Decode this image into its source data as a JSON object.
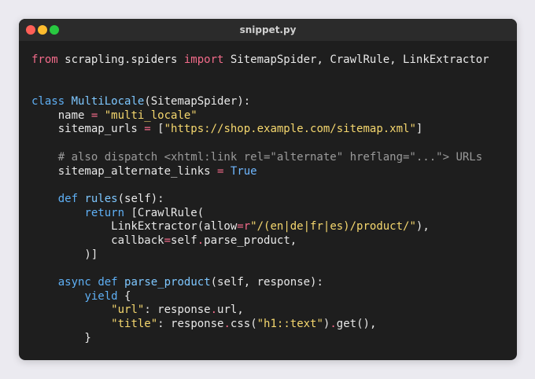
{
  "window": {
    "title": "snippet.py"
  },
  "code": {
    "lines": [
      [
        {
          "t": "from",
          "c": "kw"
        },
        {
          "t": " scrapling.spiders ",
          "c": ""
        },
        {
          "t": "import",
          "c": "kw"
        },
        {
          "t": " SitemapSpider, CrawlRule, LinkExtractor",
          "c": ""
        }
      ],
      [],
      [],
      [
        {
          "t": "class",
          "c": "kw2"
        },
        {
          "t": " ",
          "c": ""
        },
        {
          "t": "MultiLocale",
          "c": "fn"
        },
        {
          "t": "(SitemapSpider):",
          "c": ""
        }
      ],
      [
        {
          "t": "    name ",
          "c": ""
        },
        {
          "t": "=",
          "c": "op"
        },
        {
          "t": " ",
          "c": ""
        },
        {
          "t": "\"multi_locale\"",
          "c": "str"
        }
      ],
      [
        {
          "t": "    sitemap_urls ",
          "c": ""
        },
        {
          "t": "=",
          "c": "op"
        },
        {
          "t": " [",
          "c": ""
        },
        {
          "t": "\"https://shop.example.com/sitemap.xml\"",
          "c": "str"
        },
        {
          "t": "]",
          "c": ""
        }
      ],
      [],
      [
        {
          "t": "    # also dispatch <xhtml:link rel=\"alternate\" hreflang=\"...\"> URLs",
          "c": "cmt"
        }
      ],
      [
        {
          "t": "    sitemap_alternate_links ",
          "c": ""
        },
        {
          "t": "=",
          "c": "op"
        },
        {
          "t": " ",
          "c": ""
        },
        {
          "t": "True",
          "c": "cons"
        }
      ],
      [],
      [
        {
          "t": "    ",
          "c": ""
        },
        {
          "t": "def",
          "c": "kw2"
        },
        {
          "t": " ",
          "c": ""
        },
        {
          "t": "rules",
          "c": "fn"
        },
        {
          "t": "(self):",
          "c": ""
        }
      ],
      [
        {
          "t": "        ",
          "c": ""
        },
        {
          "t": "return",
          "c": "kw2"
        },
        {
          "t": " [CrawlRule(",
          "c": ""
        }
      ],
      [
        {
          "t": "            LinkExtractor(allow",
          "c": ""
        },
        {
          "t": "=",
          "c": "op"
        },
        {
          "t": "r",
          "c": "kw"
        },
        {
          "t": "\"/(en|de|fr|es)/product/\"",
          "c": "str"
        },
        {
          "t": "),",
          "c": ""
        }
      ],
      [
        {
          "t": "            callback",
          "c": ""
        },
        {
          "t": "=",
          "c": "op"
        },
        {
          "t": "self",
          "c": ""
        },
        {
          "t": ".",
          "c": "op"
        },
        {
          "t": "parse_product,",
          "c": ""
        }
      ],
      [
        {
          "t": "        )]",
          "c": ""
        }
      ],
      [],
      [
        {
          "t": "    ",
          "c": ""
        },
        {
          "t": "async",
          "c": "kw2"
        },
        {
          "t": " ",
          "c": ""
        },
        {
          "t": "def",
          "c": "kw2"
        },
        {
          "t": " ",
          "c": ""
        },
        {
          "t": "parse_product",
          "c": "fn"
        },
        {
          "t": "(self, response):",
          "c": ""
        }
      ],
      [
        {
          "t": "        ",
          "c": ""
        },
        {
          "t": "yield",
          "c": "kw2"
        },
        {
          "t": " {",
          "c": ""
        }
      ],
      [
        {
          "t": "            ",
          "c": ""
        },
        {
          "t": "\"url\"",
          "c": "str"
        },
        {
          "t": ": response",
          "c": ""
        },
        {
          "t": ".",
          "c": "op"
        },
        {
          "t": "url,",
          "c": ""
        }
      ],
      [
        {
          "t": "            ",
          "c": ""
        },
        {
          "t": "\"title\"",
          "c": "str"
        },
        {
          "t": ": response",
          "c": ""
        },
        {
          "t": ".",
          "c": "op"
        },
        {
          "t": "css(",
          "c": ""
        },
        {
          "t": "\"h1::text\"",
          "c": "str"
        },
        {
          "t": ")",
          "c": ""
        },
        {
          "t": ".",
          "c": "op"
        },
        {
          "t": "get(),",
          "c": ""
        }
      ],
      [
        {
          "t": "        }",
          "c": ""
        }
      ]
    ]
  }
}
